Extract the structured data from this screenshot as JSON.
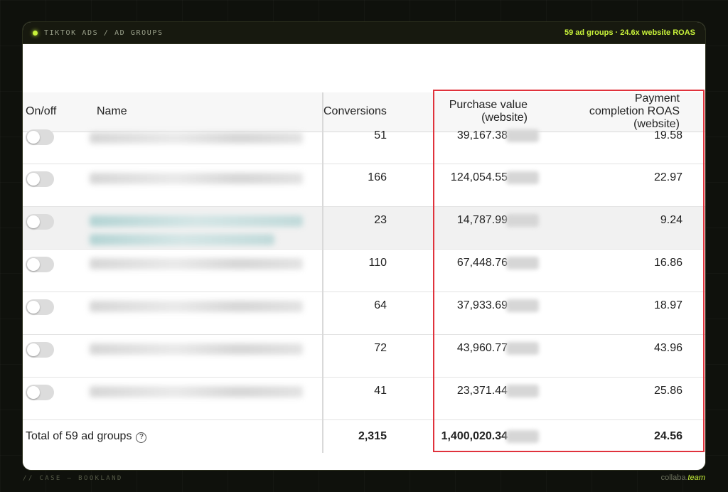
{
  "topbar": {
    "breadcrumb": "TIKTOK ADS / AD GROUPS",
    "summary": "59 ad groups · 24.6x website ROAS",
    "accent_color": "#c8f23a"
  },
  "table": {
    "columns": {
      "onoff": "On/off",
      "name": "Name",
      "conversions": "Conversions",
      "purchase_value": [
        "Purchase value",
        "(website)"
      ],
      "roas": [
        "Payment",
        "completion ROAS",
        "(website)"
      ]
    },
    "rows": [
      {
        "conversions": "51",
        "purchase_value": "39,167.38",
        "roas": "19.58"
      },
      {
        "conversions": "166",
        "purchase_value": "124,054.55",
        "roas": "22.97"
      },
      {
        "conversions": "23",
        "purchase_value": "14,787.99",
        "roas": "9.24"
      },
      {
        "conversions": "110",
        "purchase_value": "67,448.76",
        "roas": "16.86"
      },
      {
        "conversions": "64",
        "purchase_value": "37,933.69",
        "roas": "18.97"
      },
      {
        "conversions": "72",
        "purchase_value": "43,960.77",
        "roas": "43.96"
      },
      {
        "conversions": "41",
        "purchase_value": "23,371.44",
        "roas": "25.86"
      }
    ],
    "total": {
      "label": "Total of 59 ad groups",
      "help_icon": "?",
      "conversions": "2,315",
      "purchase_value": "1,400,020.34",
      "roas": "24.56"
    },
    "highlight_color": "#e0323c"
  },
  "footer": {
    "left": "// CASE — BOOKLAND",
    "brand_prefix": "collaba.",
    "brand_suffix": "team"
  }
}
